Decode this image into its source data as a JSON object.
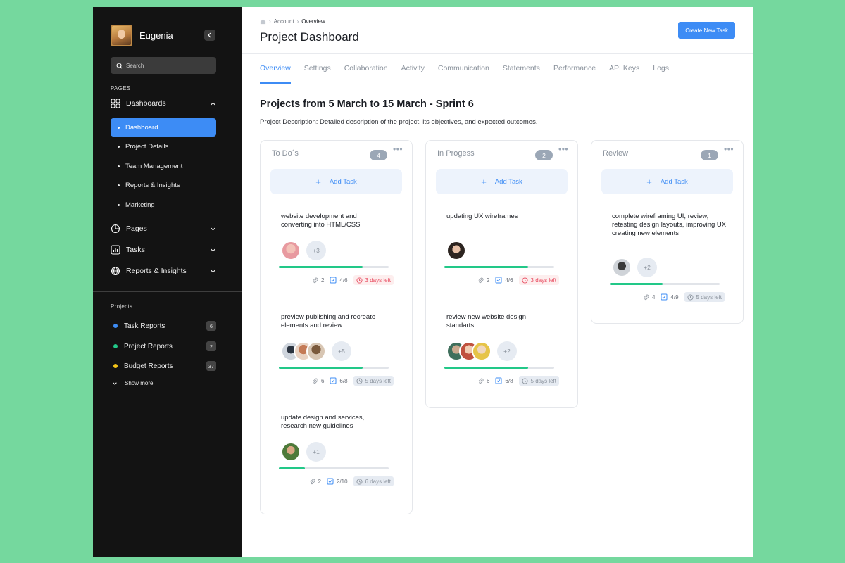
{
  "sidebar": {
    "user_name": "Eugenia",
    "search_placeholder": "Search",
    "pages_label": "PAGES",
    "dashboards": {
      "label": "Dashboards",
      "items": [
        {
          "label": "Dashboard",
          "active": true
        },
        {
          "label": "Project Details",
          "active": false
        },
        {
          "label": "Team Management",
          "active": false
        },
        {
          "label": "Reports & Insights",
          "active": false
        },
        {
          "label": "Marketing",
          "active": false
        }
      ]
    },
    "groups": [
      {
        "label": "Pages"
      },
      {
        "label": "Tasks"
      },
      {
        "label": "Reports & Insights"
      }
    ],
    "projects_label": "Projects",
    "projects": [
      {
        "label": "Task Reports",
        "count": "6",
        "color": "#3d8cf5"
      },
      {
        "label": "Project Reports",
        "count": "2",
        "color": "#22c888"
      },
      {
        "label": "Budget Reports",
        "count": "37",
        "color": "#f5c518"
      }
    ],
    "show_more": "Show more"
  },
  "header": {
    "breadcrumb": [
      "Account",
      "Overview"
    ],
    "title": "Project Dashboard",
    "create_button": "Create New Task"
  },
  "tabs": [
    {
      "label": "Overview",
      "active": true
    },
    {
      "label": "Settings"
    },
    {
      "label": "Collaboration"
    },
    {
      "label": "Activity"
    },
    {
      "label": "Communication"
    },
    {
      "label": "Statements"
    },
    {
      "label": "Performance"
    },
    {
      "label": "API Keys"
    },
    {
      "label": "Logs"
    }
  ],
  "section": {
    "title": "Projects from 5 March to 15 March - Sprint 6",
    "description": "Project Description: Detailed description of the project, its objectives, and expected outcomes."
  },
  "board": {
    "add_task_label": "Add Task",
    "columns": [
      {
        "title": "To Do´s",
        "count": "4",
        "cards": [
          {
            "text": "website development and converting into HTML/CSS",
            "more": "+3",
            "progress": 0.76,
            "attachments": "2",
            "checks": "4/6",
            "due": "3 days left",
            "urgent": true
          },
          {
            "text": "preview publishing and recreate elements and review",
            "more": "+5",
            "progress": 0.76,
            "attachments": "6",
            "checks": "6/8",
            "due": "5 days left",
            "urgent": false
          },
          {
            "text": "update design and services, research new guidelines",
            "more": "+1",
            "progress": 0.24,
            "attachments": "2",
            "checks": "2/10",
            "due": "6 days left",
            "urgent": false
          }
        ]
      },
      {
        "title": "In Progess",
        "count": "2",
        "cards": [
          {
            "text": "updating UX wireframes",
            "more": "",
            "progress": 0.76,
            "attachments": "2",
            "checks": "4/6",
            "due": "3 days left",
            "urgent": true
          },
          {
            "text": "review new website design standarts",
            "more": "+2",
            "progress": 0.76,
            "attachments": "6",
            "checks": "6/8",
            "due": "5 days left",
            "urgent": false
          }
        ]
      },
      {
        "title": "Review",
        "count": "1",
        "cards": [
          {
            "text": "complete wireframing UI, review, retesting design layouts, improving UX, creating new elements",
            "more": "+2",
            "progress": 0.48,
            "attachments": "4",
            "checks": "4/9",
            "due": "5 days left",
            "urgent": false
          }
        ]
      }
    ]
  }
}
